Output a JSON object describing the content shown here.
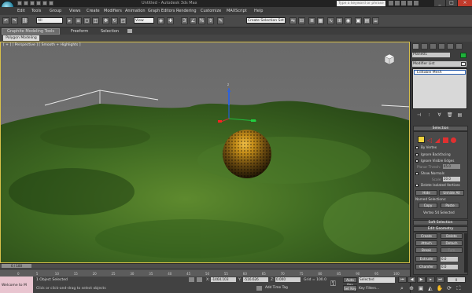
{
  "app": {
    "title_text": "Untitled - Autodesk 3ds Max",
    "search_placeholder": "Type a keyword or phrase"
  },
  "window_controls": {
    "minimize": "_",
    "maximize": "□",
    "close": "×"
  },
  "menus": [
    "Edit",
    "Tools",
    "Group",
    "Views",
    "Create",
    "Modifiers",
    "Animation",
    "Graph Editors",
    "Rendering",
    "Customize",
    "MAXScript",
    "Help"
  ],
  "toolbar": {
    "selection_filter": "All",
    "ref_coord": "View",
    "named_sel": "Create Selection Set"
  },
  "ribbon": {
    "tabs": [
      "Graphite Modeling Tools",
      "Freeform",
      "Selection"
    ],
    "panel_button": "Polygon Modeling"
  },
  "viewport": {
    "label": "[ + ] [ Perspective ] [ Smooth + Highlights ]",
    "gizmo_axis": "z"
  },
  "command_panel": {
    "object_name": "Plane01",
    "object_color": "#1fb03a",
    "modifier_list": "Modifier List",
    "stack_item": "Editable Mesh",
    "selection": {
      "title": "Selection",
      "by_vertex": "By Vertex",
      "ignore_backfacing": "Ignore Backfacing",
      "ignore_visible_edges": "Ignore Visible Edges",
      "planar_thresh": "Planar Thresh:",
      "planar_thresh_value": "45.0",
      "show_normals": "Show Normals",
      "scale": "Scale:",
      "scale_value": "20.0",
      "delete_isolated": "Delete Isolated Vertices",
      "hide": "Hide",
      "unhide_all": "Unhide All",
      "named_selections": "Named Selections:",
      "copy": "Copy",
      "paste": "Paste",
      "status": "Vertex 54 Selected"
    },
    "soft_selection": {
      "title": "Soft Selection"
    },
    "edit_geometry": {
      "title": "Edit Geometry",
      "create": "Create",
      "delete": "Delete",
      "attach": "Attach",
      "detach": "Detach",
      "break": "Break",
      "turn": "Turn",
      "extrude": "Extrude",
      "extrude_value": "0.0",
      "chamfer": "Chamfer",
      "chamfer_value": "0.0"
    }
  },
  "timeline": {
    "slider": "0 / 100",
    "ticks": [
      "0",
      "5",
      "10",
      "15",
      "20",
      "25",
      "30",
      "35",
      "40",
      "45",
      "50",
      "55",
      "60",
      "65",
      "70",
      "75",
      "80",
      "85",
      "90",
      "95",
      "100"
    ]
  },
  "status": {
    "welcome": "Welcome to M",
    "line1": "1 Object Selected",
    "line2": "Click or click-and-drag to select objects",
    "x_label": "X:",
    "x_value": "-1464.103",
    "y_label": "Y:",
    "y_value": "-516.626",
    "z_label": "Z:",
    "z_value": "0.000",
    "grid": "Grid = 100.0",
    "add_time_tag": "Add Time Tag",
    "auto_key": "Auto Key",
    "set_key": "Set Key",
    "key_mode": "Selected",
    "key_filters": "Key Filters..."
  },
  "colors": {
    "accent_yellow": "#f0d23c",
    "viewport_border": "#d8c04a",
    "sphere": "#8a6a1a"
  }
}
